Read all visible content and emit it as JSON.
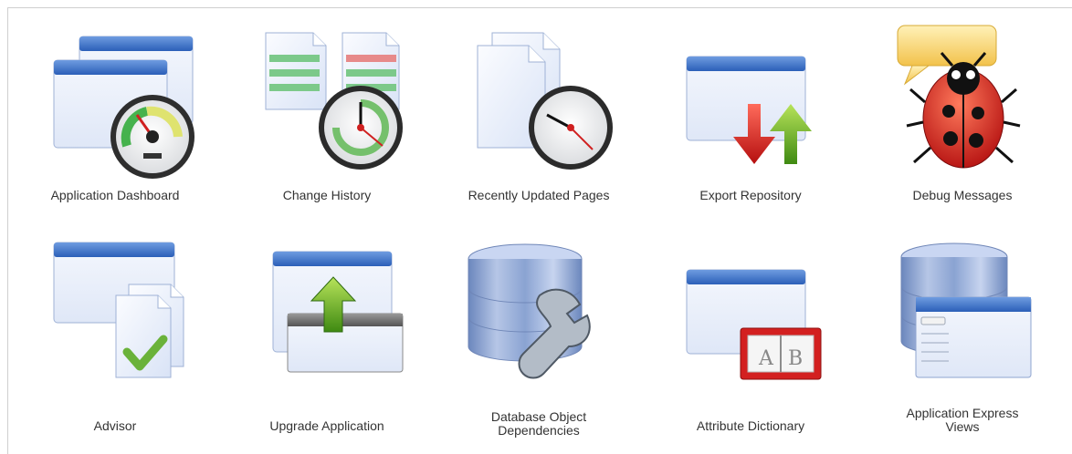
{
  "tiles": [
    {
      "id": "application-dashboard",
      "label": "Application Dashboard",
      "icon": "dashboard-gauge-icon"
    },
    {
      "id": "change-history",
      "label": "Change History",
      "icon": "change-history-clock-icon"
    },
    {
      "id": "recently-updated-pages",
      "label": "Recently Updated Pages",
      "icon": "pages-clock-icon"
    },
    {
      "id": "export-repository",
      "label": "Export Repository",
      "icon": "export-arrows-icon"
    },
    {
      "id": "debug-messages",
      "label": "Debug Messages",
      "icon": "ladybug-icon"
    },
    {
      "id": "advisor",
      "label": "Advisor",
      "icon": "advisor-check-icon"
    },
    {
      "id": "upgrade-application",
      "label": "Upgrade Application",
      "icon": "upgrade-arrow-icon"
    },
    {
      "id": "database-object-dependencies",
      "label": "Database Object Dependencies",
      "label_line1": "Database Object",
      "label_line2": "Dependencies",
      "icon": "database-wrench-icon"
    },
    {
      "id": "attribute-dictionary",
      "label": "Attribute Dictionary",
      "icon": "dictionary-book-icon"
    },
    {
      "id": "application-express-views",
      "label": "Application Express Views",
      "label_line1": "Application Express",
      "label_line2": "Views",
      "icon": "database-window-icon"
    }
  ]
}
